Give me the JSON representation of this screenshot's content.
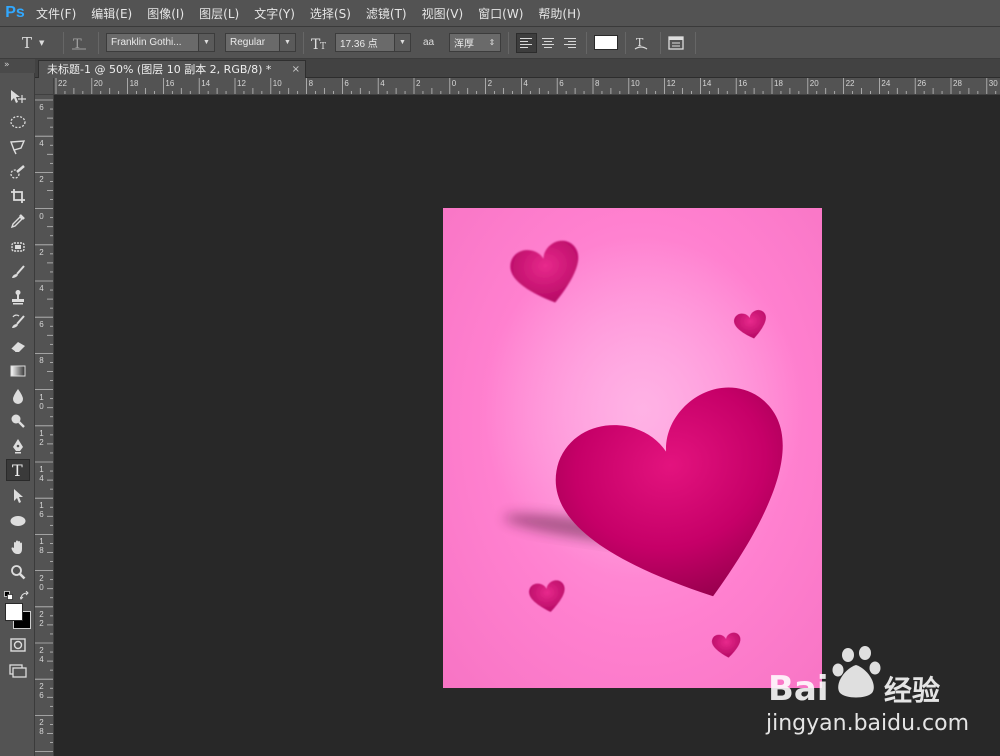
{
  "app": {
    "logo": "Ps"
  },
  "menu": [
    "文件(F)",
    "编辑(E)",
    "图像(I)",
    "图层(L)",
    "文字(Y)",
    "选择(S)",
    "滤镜(T)",
    "视图(V)",
    "窗口(W)",
    "帮助(H)"
  ],
  "options": {
    "font_family": "Franklin Gothi...",
    "font_style": "Regular",
    "font_size": "17.36 点",
    "antialias_label": "aa",
    "antialias": "浑厚",
    "text_color": "#ffffff"
  },
  "document_tab": {
    "title": "未标题-1 @ 50% (图层 10 副本 2, RGB/8) *",
    "close": "×"
  },
  "toolbar": {
    "collapse": "»",
    "tools": [
      "move-icon",
      "elliptical-marquee-icon",
      "polygonal-lasso-icon",
      "quick-selection-icon",
      "crop-icon",
      "eyedropper-icon",
      "spot-healing-icon",
      "brush-icon",
      "clone-stamp-icon",
      "history-brush-icon",
      "eraser-icon",
      "gradient-icon",
      "blur-icon",
      "dodge-icon",
      "pen-icon",
      "type-icon",
      "path-selection-icon",
      "ellipse-shape-icon",
      "hand-icon",
      "zoom-icon"
    ],
    "active_tool": "type-icon",
    "foreground_color": "#ffffff",
    "background_color": "#000000"
  },
  "rulers": {
    "horizontal": [
      "22",
      "20",
      "18",
      "16",
      "14",
      "12",
      "10",
      "8",
      "6",
      "4",
      "2",
      "0",
      "2",
      "4",
      "6",
      "8",
      "10",
      "12",
      "14",
      "16",
      "18",
      "20",
      "22",
      "24",
      "26",
      "28",
      "30"
    ],
    "vertical": [
      "6",
      "4",
      "2",
      "0",
      "2",
      "4",
      "6",
      "8",
      "10",
      "12",
      "14",
      "16",
      "18",
      "20",
      "22",
      "24",
      "26",
      "28",
      "30"
    ]
  },
  "watermark": {
    "brand_latin": "Bai",
    "brand_cn": "经验",
    "url": "jingyan.baidu.com"
  },
  "colors": {
    "canvas_pink": "#ff80cf",
    "heart_magenta": "#cc0066",
    "panel": "#535353",
    "workspace": "#282828"
  }
}
